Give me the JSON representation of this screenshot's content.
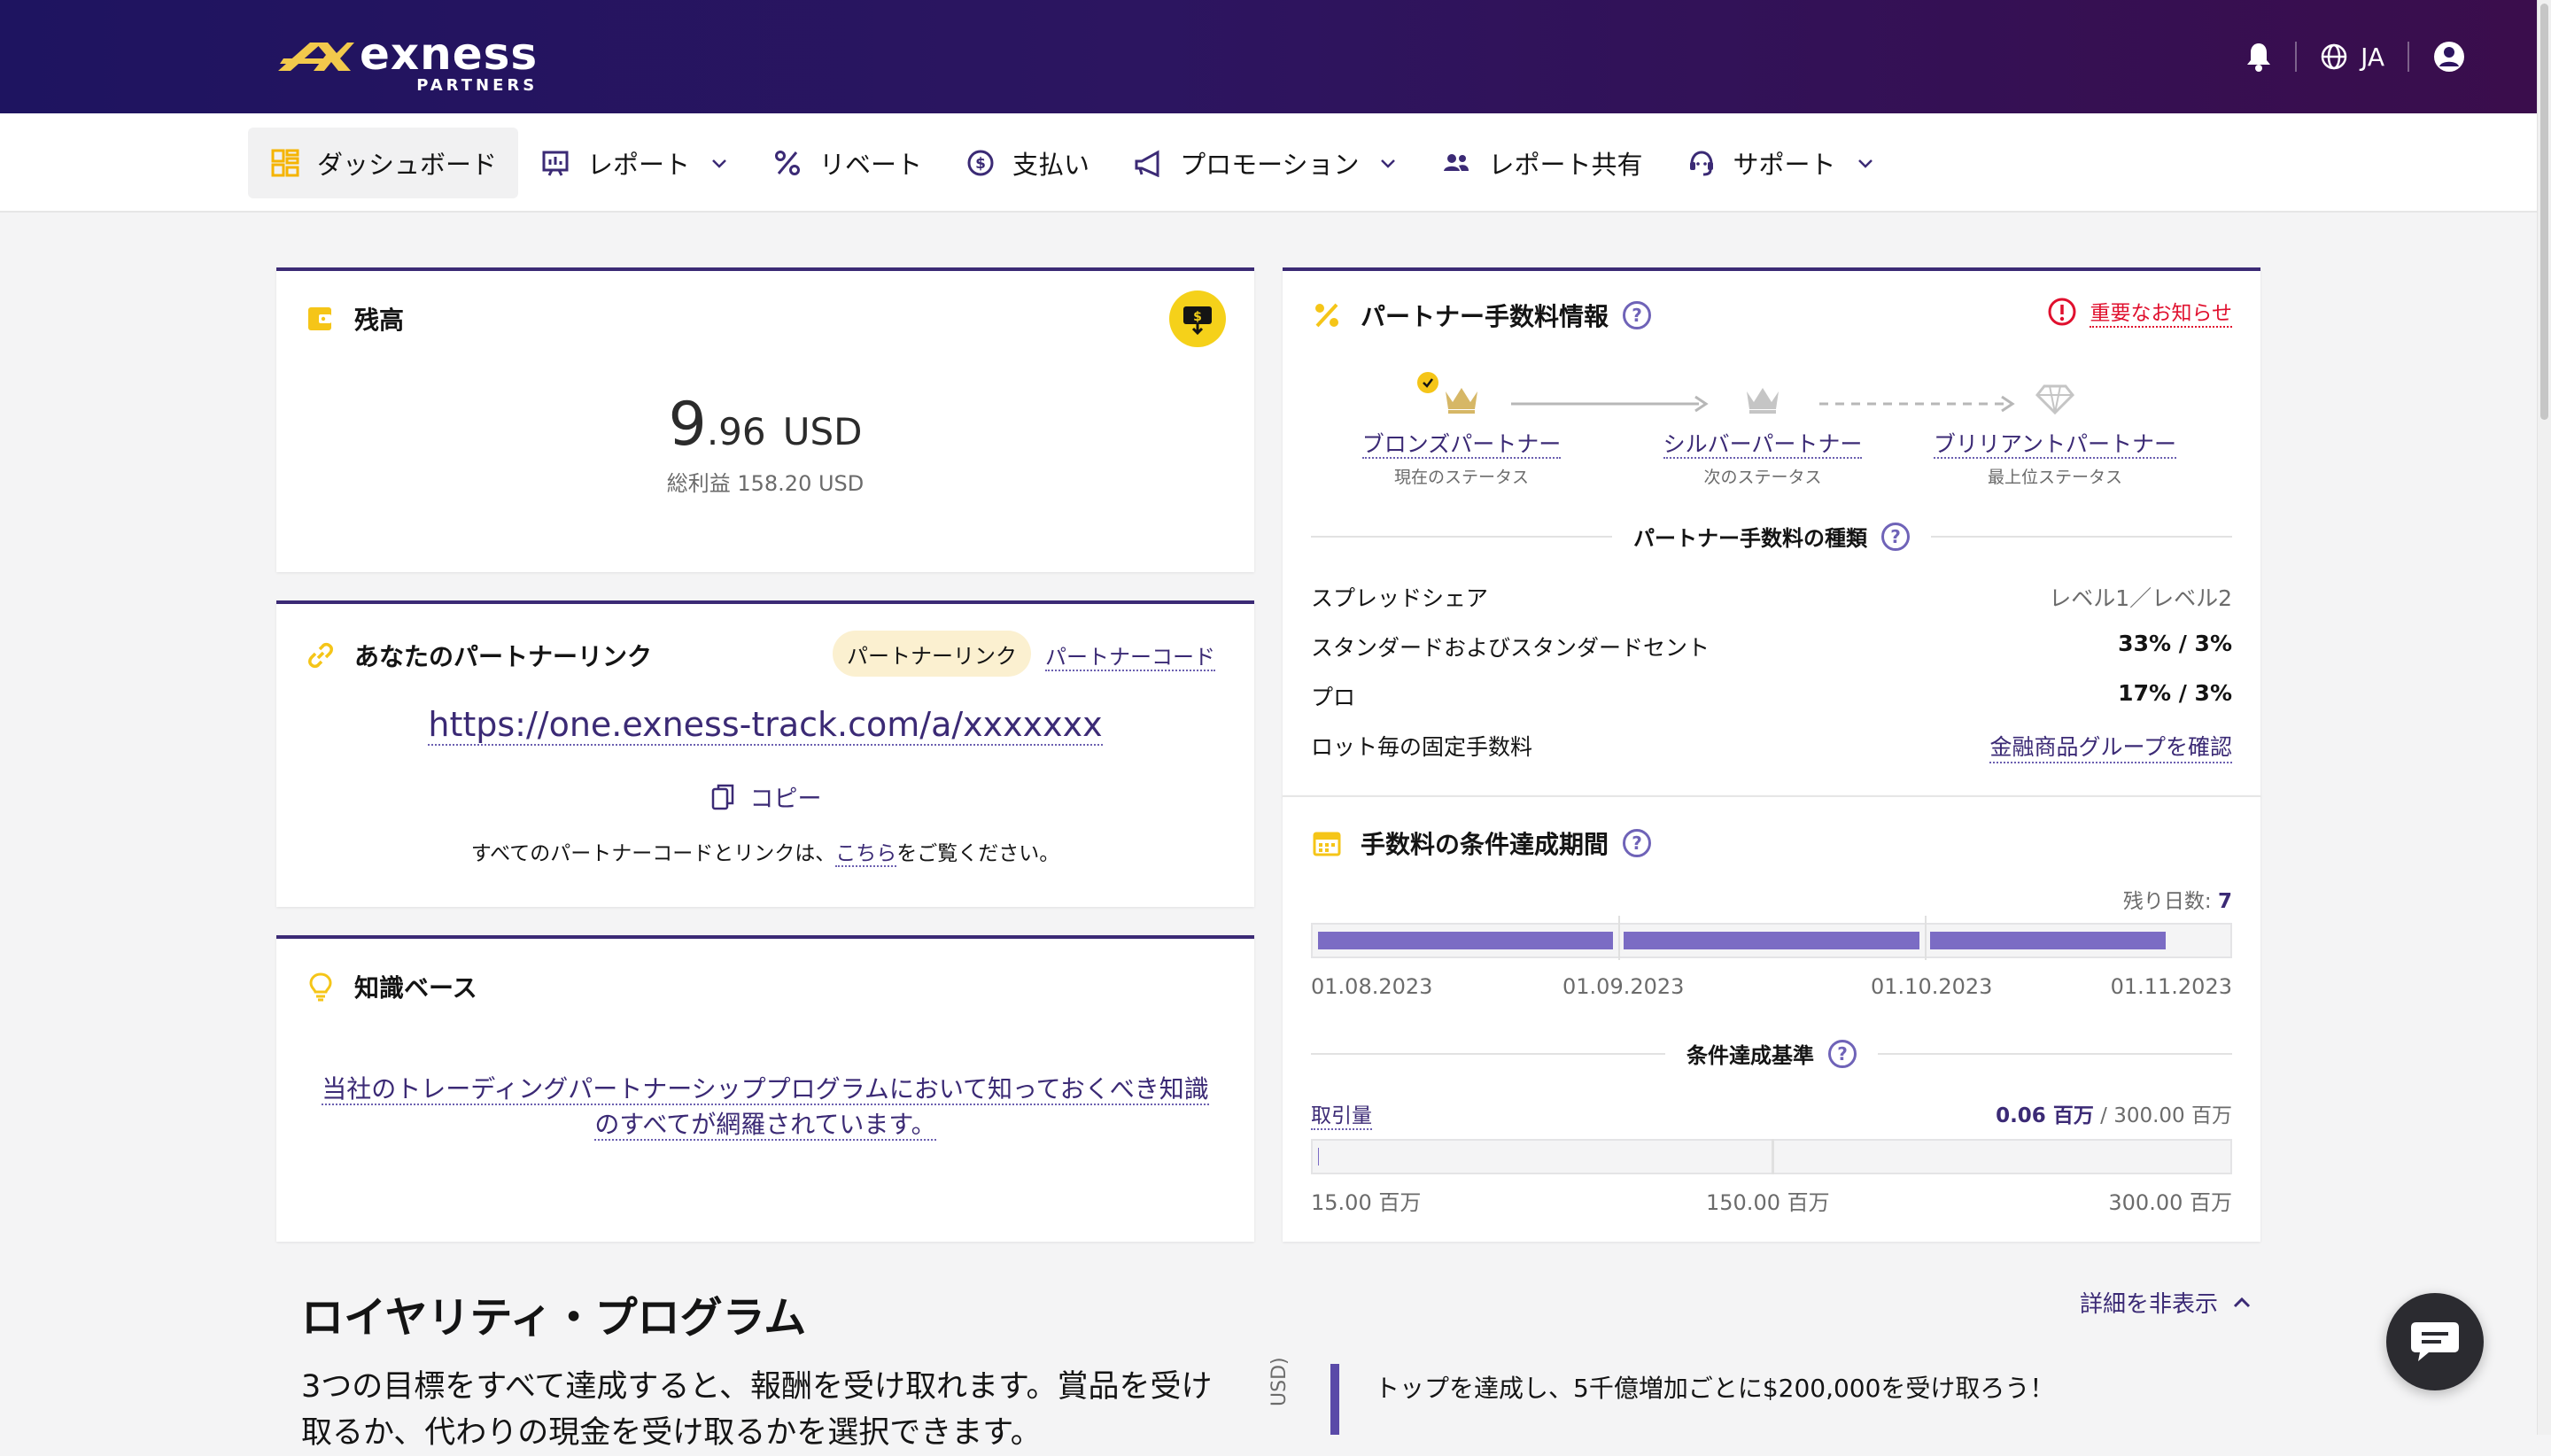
{
  "brand": {
    "word": "exness",
    "sub": "PARTNERS"
  },
  "header": {
    "language": "JA",
    "icons": [
      "bell-icon",
      "globe-icon",
      "user-account-icon"
    ]
  },
  "nav": {
    "items": [
      {
        "label": "ダッシュボード",
        "icon": "dashboard-icon",
        "active": true,
        "dropdown": false
      },
      {
        "label": "レポート",
        "icon": "chart-icon",
        "active": false,
        "dropdown": true
      },
      {
        "label": "リベート",
        "icon": "percent-icon",
        "active": false,
        "dropdown": false
      },
      {
        "label": "支払い",
        "icon": "dollar-coin-icon",
        "active": false,
        "dropdown": false
      },
      {
        "label": "プロモーション",
        "icon": "megaphone-icon",
        "active": false,
        "dropdown": true
      },
      {
        "label": "レポート共有",
        "icon": "users-icon",
        "active": false,
        "dropdown": false
      },
      {
        "label": "サポート",
        "icon": "headset-icon",
        "active": false,
        "dropdown": true
      }
    ]
  },
  "balance": {
    "title": "残高",
    "amount_int": "9",
    "amount_dec": ".96",
    "currency": "USD",
    "total_label": "総利益 158.20 USD"
  },
  "partner_link": {
    "title": "あなたのパートナーリンク",
    "tab_link": "パートナーリンク",
    "tab_code": "パートナーコード",
    "url": "https://one.exness-track.com/a/xxxxxxx",
    "copy_label": "コピー",
    "note_before": "すべてのパートナーコードとリンクは、",
    "note_link": "こちら",
    "note_after": "をご覧ください。"
  },
  "knowledge": {
    "title": "知識ベース",
    "text_line1": "当社のトレーディングパートナーシッププログラムにおいて知っておくべき知識",
    "text_line2": "のすべてが網羅されています。"
  },
  "commission": {
    "title": "パートナー手数料情報",
    "notice": "重要なお知らせ",
    "statuses": [
      {
        "name": "ブロンズパートナー",
        "caption": "現在のステータス",
        "color": "#d6b766"
      },
      {
        "name": "シルバーパートナー",
        "caption": "次のステータス",
        "color": "#c5c5c5"
      },
      {
        "name": "ブリリアントパートナー",
        "caption": "最上位ステータス",
        "color": "#c5c5c5"
      }
    ],
    "types_title": "パートナー手数料の種類",
    "rows": [
      {
        "label": "スプレッドシェア",
        "value": "レベル1／レベル2"
      },
      {
        "label": "スタンダードおよびスタンダードセント",
        "value": "33% / 3%"
      },
      {
        "label": "プロ",
        "value": "17% / 3%"
      },
      {
        "label": "ロット毎の固定手数料",
        "value": "金融商品グループを確認"
      }
    ]
  },
  "period": {
    "title": "手数料の条件達成期間",
    "remaining_label": "残り日数:",
    "remaining_value": "7",
    "dates": [
      "01.08.2023",
      "01.09.2023",
      "01.10.2023",
      "01.11.2023"
    ],
    "progress": [
      1.0,
      1.0,
      0.8
    ],
    "criteria_title": "条件達成基準",
    "volume_label": "取引量",
    "volume_current": "0.06 百万",
    "volume_sep": " / ",
    "volume_target": "300.00 百万",
    "volume_fraction": 0.0002,
    "volume_ticks": [
      "15.00 百万",
      "150.00 百万",
      "300.00 百万"
    ]
  },
  "loyalty": {
    "title": "ロイヤリティ・プログラム",
    "toggle": "詳細を非表示",
    "desc_line1": "3つの目標をすべて達成すると、報酬を受け取れます。賞品を受け",
    "desc_line2": "取るか、代わりの現金を受け取るかを選択できます。",
    "axis_unit": "USD)",
    "highlight": "トップを達成し、5千億増加ごとに$200,000を受け取ろう！"
  },
  "colors": {
    "accent": "#3b2a75",
    "bar": "#7b6cc4",
    "alert": "#e0102e",
    "yellow": "#f5d11a"
  }
}
